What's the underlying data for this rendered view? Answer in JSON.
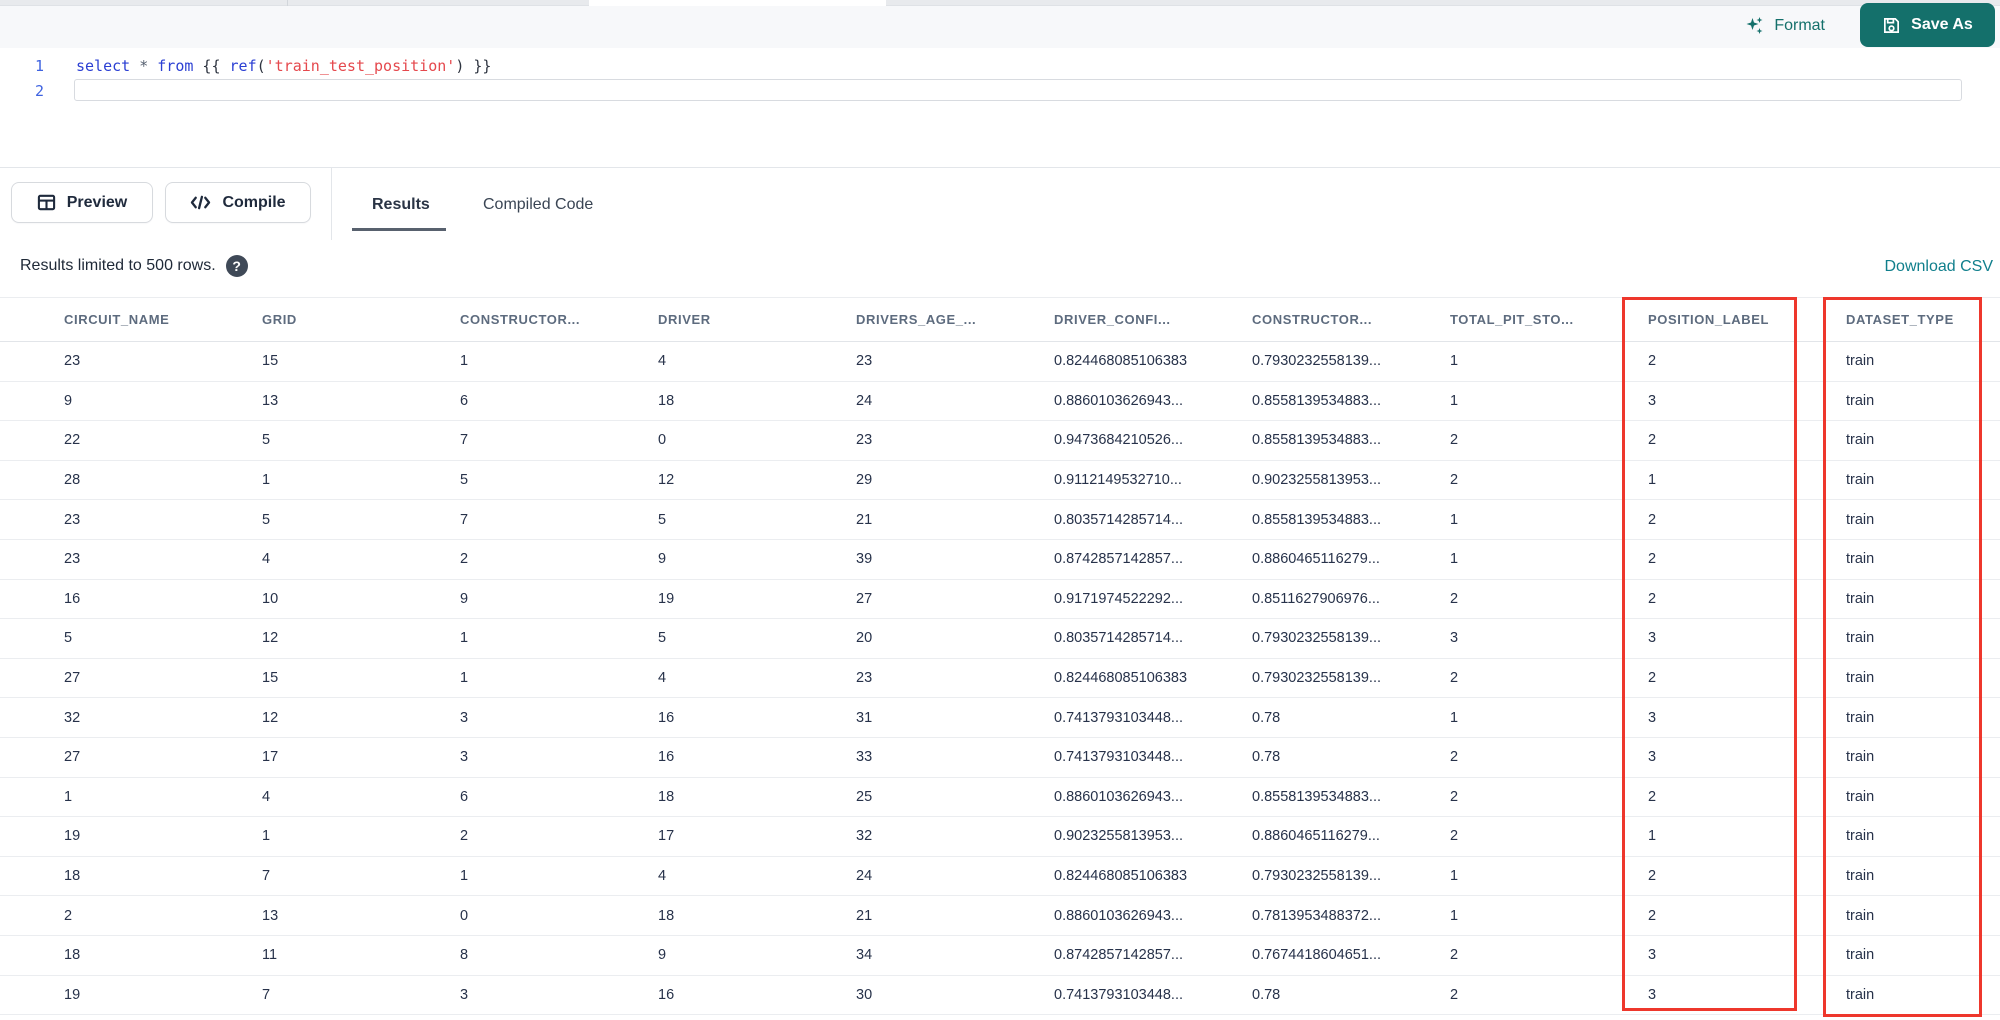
{
  "colors": {
    "teal": "#14706b",
    "teal-link": "#107f8c",
    "red": "#ee372c",
    "kw": "#2b3fd3",
    "str": "#e5484d",
    "punct": "#2e3440",
    "op": "#566070",
    "linenum": "#3f63e0",
    "text": "#222f43",
    "muted": "#5d6b7e",
    "border": "#e3e6ea",
    "rowborder": "#ebedf0"
  },
  "editor_header": {
    "format_label": "Format",
    "save_as_label": "Save As"
  },
  "editor": {
    "line1_number": "1",
    "line2_number": "2",
    "code_tokens": [
      {
        "text": "select",
        "type": "keyword"
      },
      {
        "text": " ",
        "type": "plain"
      },
      {
        "text": "*",
        "type": "operator"
      },
      {
        "text": " ",
        "type": "plain"
      },
      {
        "text": "from",
        "type": "keyword"
      },
      {
        "text": " {{ ",
        "type": "punct"
      },
      {
        "text": "ref",
        "type": "function"
      },
      {
        "text": "(",
        "type": "punct"
      },
      {
        "text": "'train_test_position'",
        "type": "string"
      },
      {
        "text": ") }}",
        "type": "punct"
      }
    ]
  },
  "toolbar": {
    "preview_label": "Preview",
    "compile_label": "Compile",
    "tabs": [
      {
        "label": "Results",
        "active": true
      },
      {
        "label": "Compiled Code",
        "active": false
      }
    ]
  },
  "results_bar": {
    "info": "Results limited to 500 rows.",
    "help_icon": "?",
    "download_label": "Download CSV"
  },
  "table": {
    "columns": [
      "CIRCUIT_NAME",
      "GRID",
      "CONSTRUCTOR...",
      "DRIVER",
      "DRIVERS_AGE_...",
      "DRIVER_CONFI...",
      "CONSTRUCTOR...",
      "TOTAL_PIT_STO...",
      "POSITION_LABEL",
      "DATASET_TYPE"
    ],
    "rows": [
      [
        "23",
        "15",
        "1",
        "4",
        "23",
        "0.824468085106383",
        "0.7930232558139...",
        "1",
        "2",
        "train"
      ],
      [
        "9",
        "13",
        "6",
        "18",
        "24",
        "0.8860103626943...",
        "0.8558139534883...",
        "1",
        "3",
        "train"
      ],
      [
        "22",
        "5",
        "7",
        "0",
        "23",
        "0.9473684210526...",
        "0.8558139534883...",
        "2",
        "2",
        "train"
      ],
      [
        "28",
        "1",
        "5",
        "12",
        "29",
        "0.9112149532710...",
        "0.9023255813953...",
        "2",
        "1",
        "train"
      ],
      [
        "23",
        "5",
        "7",
        "5",
        "21",
        "0.8035714285714...",
        "0.8558139534883...",
        "1",
        "2",
        "train"
      ],
      [
        "23",
        "4",
        "2",
        "9",
        "39",
        "0.8742857142857...",
        "0.8860465116279...",
        "1",
        "2",
        "train"
      ],
      [
        "16",
        "10",
        "9",
        "19",
        "27",
        "0.9171974522292...",
        "0.8511627906976...",
        "2",
        "2",
        "train"
      ],
      [
        "5",
        "12",
        "1",
        "5",
        "20",
        "0.8035714285714...",
        "0.7930232558139...",
        "3",
        "3",
        "train"
      ],
      [
        "27",
        "15",
        "1",
        "4",
        "23",
        "0.824468085106383",
        "0.7930232558139...",
        "2",
        "2",
        "train"
      ],
      [
        "32",
        "12",
        "3",
        "16",
        "31",
        "0.7413793103448...",
        "0.78",
        "1",
        "3",
        "train"
      ],
      [
        "27",
        "17",
        "3",
        "16",
        "33",
        "0.7413793103448...",
        "0.78",
        "2",
        "3",
        "train"
      ],
      [
        "1",
        "4",
        "6",
        "18",
        "25",
        "0.8860103626943...",
        "0.8558139534883...",
        "2",
        "2",
        "train"
      ],
      [
        "19",
        "1",
        "2",
        "17",
        "32",
        "0.9023255813953...",
        "0.8860465116279...",
        "2",
        "1",
        "train"
      ],
      [
        "18",
        "7",
        "1",
        "4",
        "24",
        "0.824468085106383",
        "0.7930232558139...",
        "1",
        "2",
        "train"
      ],
      [
        "2",
        "13",
        "0",
        "18",
        "21",
        "0.8860103626943...",
        "0.7813953488372...",
        "1",
        "2",
        "train"
      ],
      [
        "18",
        "11",
        "8",
        "9",
        "34",
        "0.8742857142857...",
        "0.7674418604651...",
        "2",
        "3",
        "train"
      ],
      [
        "19",
        "7",
        "3",
        "16",
        "30",
        "0.7413793103448...",
        "0.78",
        "2",
        "3",
        "train"
      ]
    ]
  }
}
